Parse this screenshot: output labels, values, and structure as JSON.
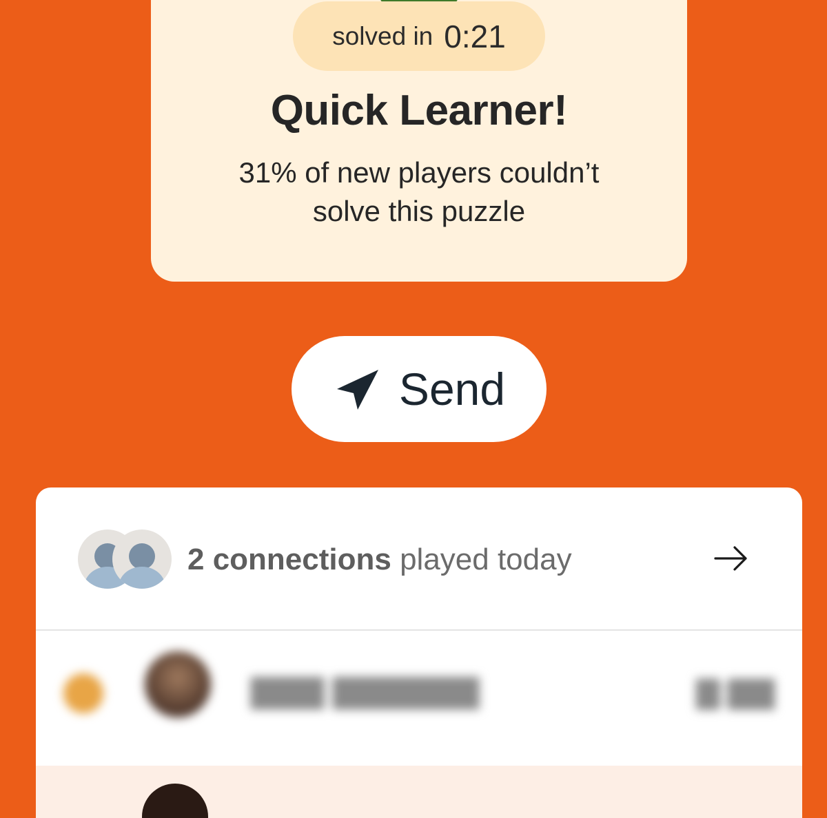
{
  "result": {
    "timer_label": "solved in",
    "timer_value": "0:21",
    "title": "Quick Learner!",
    "subtitle": "31% of new players couldn’t solve this puzzle"
  },
  "send": {
    "label": "Send",
    "icon": "paper-plane-icon"
  },
  "connections": {
    "count_text": "2 connections",
    "suffix_text": "played today",
    "arrow_icon": "arrow-right-icon",
    "leaderboard": [
      {
        "name": "",
        "time": "",
        "blurred": true
      }
    ]
  },
  "colors": {
    "background": "#ec5d18",
    "card": "#fff2dd",
    "timer_pill": "#fde3b6",
    "panel": "#ffffff",
    "highlight_row": "#fdeee5"
  }
}
